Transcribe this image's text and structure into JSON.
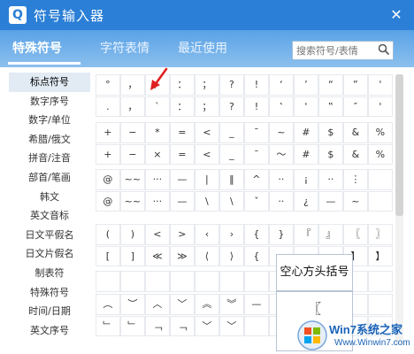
{
  "titlebar": {
    "app_icon": "Q",
    "title": "符号输入器",
    "close_glyph": "✕"
  },
  "tabs": [
    {
      "label": "特殊符号",
      "active": true
    },
    {
      "label": "字符表情",
      "active": false
    },
    {
      "label": "最近使用",
      "active": false
    }
  ],
  "search": {
    "placeholder": "搜索符号/表情"
  },
  "sidebar": {
    "items": [
      "标点符号",
      "数字序号",
      "数字/单位",
      "希腊/俄文",
      "拼音/注音",
      "部首/笔画",
      "韩文",
      "英文音标",
      "日文平假名",
      "日文片假名",
      "制表符",
      "特殊符号",
      "时间/日期",
      "英文序号"
    ],
    "active_index": 0
  },
  "grid": {
    "rows": [
      [
        "°",
        "，",
        "、",
        "：",
        "；",
        "?",
        "!",
        "‘",
        "’",
        "“",
        "”",
        "'"
      ],
      [
        ".",
        "，",
        "`",
        "：",
        "；",
        "?",
        "!",
        "‛",
        "'",
        "‟",
        "″",
        "'"
      ],
      [
        "+",
        "−",
        "*",
        "=",
        "<",
        "_",
        "¯",
        "~",
        "#",
        "$",
        "&",
        "%"
      ],
      [
        "+",
        "−",
        "×",
        "=",
        "<",
        "_",
        "¯",
        "～",
        "#",
        "$",
        "&",
        "%"
      ],
      [
        "@",
        "~~",
        "···",
        "—",
        "|",
        "‖",
        "^",
        "··",
        "¡",
        "··",
        "⋮",
        ""
      ],
      [
        "@",
        "~~",
        "···",
        "—",
        "\\",
        "\\",
        "ˇ",
        "··",
        "¿",
        "—",
        "~",
        ""
      ],
      [
        "(",
        ")",
        "<",
        ">",
        "‹",
        "›",
        "{",
        "}",
        "『",
        "』",
        "〖",
        "〗"
      ],
      [
        "[",
        "]",
        "≪",
        "≫",
        "⟨",
        "⟩",
        "{",
        "",
        "",
        "",
        "】",
        "】"
      ],
      [
        "",
        "",
        "",
        "",
        "",
        "",
        "",
        "",
        "",
        "",
        "",
        ""
      ],
      [
        "︵",
        "︶",
        "︿",
        "﹀",
        "︽",
        "︾",
        "—",
        "¬",
        "",
        "",
        "",
        ""
      ],
      [
        "﹂",
        "﹂",
        "﹁",
        "﹁",
        "﹀",
        "﹀",
        "",
        "",
        "",
        "",
        "",
        ""
      ]
    ]
  },
  "tooltip": {
    "label": "空心方头括号",
    "preview_char": "〖"
  },
  "watermark": {
    "brand": "Win7系统之家",
    "url": "Www.Winwin7.com"
  },
  "colors": {
    "titlebar": "#2b7fd6",
    "tab_bg": "#6aaee9",
    "accent": "#2b7fd6"
  },
  "icons": {
    "close": "close-icon",
    "search": "search-icon",
    "arrow": "red-arrow-icon"
  }
}
